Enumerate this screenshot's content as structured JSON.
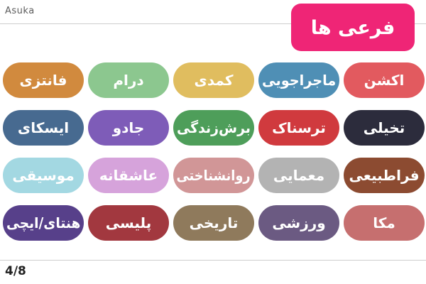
{
  "app": {
    "name": "Asuka"
  },
  "header": {
    "title": "فرعی ها"
  },
  "genres": [
    {
      "label": "اکشن",
      "color": "#e25a5f"
    },
    {
      "label": "ماجراجویی",
      "color": "#4f8fb5"
    },
    {
      "label": "کمدی",
      "color": "#e0bd5f"
    },
    {
      "label": "درام",
      "color": "#8cc78f"
    },
    {
      "label": "فانتزی",
      "color": "#d18a3e"
    },
    {
      "label": "تخیلی",
      "color": "#2c2c3c"
    },
    {
      "label": "ترسناک",
      "color": "#d03a3e"
    },
    {
      "label": "برش‌زندگی",
      "color": "#4e9e5a"
    },
    {
      "label": "جادو",
      "color": "#7e5cb8"
    },
    {
      "label": "ایسکای",
      "color": "#476a90"
    },
    {
      "label": "فراطبیعی",
      "color": "#8c4b31"
    },
    {
      "label": "معمایی",
      "color": "#b3b3b3"
    },
    {
      "label": "روانشناختی",
      "color": "#d19697"
    },
    {
      "label": "عاشقانه",
      "color": "#d6a3db"
    },
    {
      "label": "موسیقی",
      "color": "#a3d8e2"
    },
    {
      "label": "مکا",
      "color": "#c66f6f"
    },
    {
      "label": "ورزشی",
      "color": "#6b5a82"
    },
    {
      "label": "تاریخی",
      "color": "#8f7a5c"
    },
    {
      "label": "پلیسی",
      "color": "#a2383f"
    },
    {
      "label": "هنتای/ایچی",
      "color": "#57408a"
    }
  ],
  "footer": {
    "page": "4/8"
  }
}
